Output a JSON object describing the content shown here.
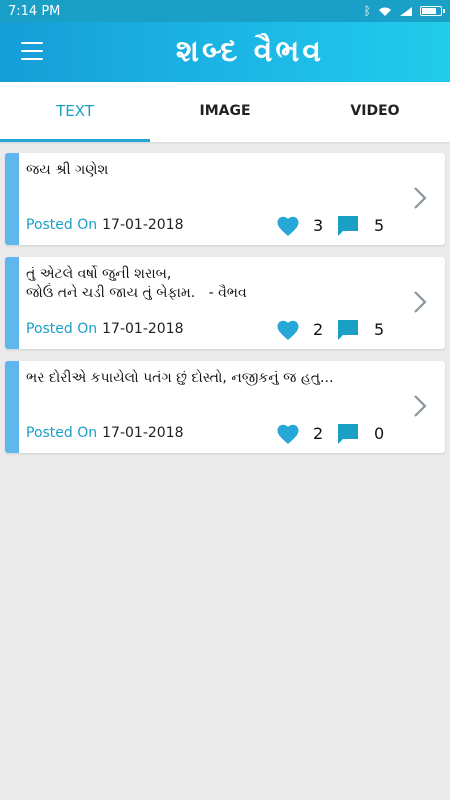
{
  "status": {
    "time": "7:14 PM"
  },
  "app": {
    "title": "શબ્દ વૈભવ"
  },
  "tabs": [
    {
      "label": "TEXT",
      "active": true
    },
    {
      "label": "IMAGE",
      "active": false
    },
    {
      "label": "VIDEO",
      "active": false
    }
  ],
  "posted_label": "Posted On",
  "posts": [
    {
      "lines": [
        "જય શ્રી ગણેશ"
      ],
      "date": "17-01-2018",
      "likes": "3",
      "comments": "5"
    },
    {
      "lines": [
        "તું એટલે વર્ષો જુની શરાબ,",
        "જોઉં તને ચડી જાય તું બેફામ.   - વૈભવ"
      ],
      "date": "17-01-2018",
      "likes": "2",
      "comments": "5"
    },
    {
      "lines": [
        "ભર દોરીએ કપાયેલો પતંગ છું દોસ્તો, નજીકનું જ હતુ..."
      ],
      "date": "17-01-2018",
      "likes": "2",
      "comments": "0"
    }
  ],
  "colors": {
    "accent": "#1a9fc7",
    "card_bar": "#5fb7ef",
    "heart": "#27a7d8"
  }
}
